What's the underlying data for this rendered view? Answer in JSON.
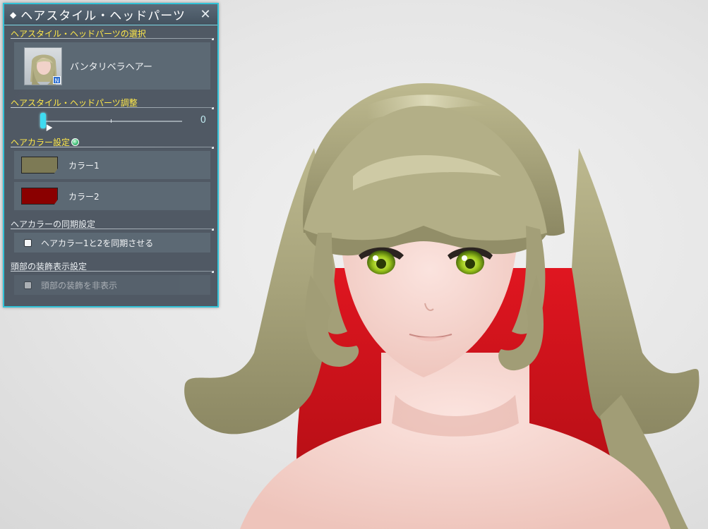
{
  "panel": {
    "title": "ヘアスタイル・ヘッドパーツ",
    "close_symbol": "✕"
  },
  "hair_select": {
    "heading": "ヘアスタイル・ヘッドパーツの選択",
    "selected_name": "バンタリベラヘアー",
    "thumb_badge": "N"
  },
  "hair_adjust": {
    "heading": "ヘアスタイル・ヘッドパーツ調整",
    "value": "0",
    "level_fraction": 0
  },
  "hair_color": {
    "heading": "ヘアカラー設定",
    "colors": [
      {
        "label": "カラー1",
        "hex": "#7d7a55"
      },
      {
        "label": "カラー2",
        "hex": "#8a0000"
      }
    ]
  },
  "sync": {
    "heading": "ヘアカラーの同期設定",
    "checkbox_label": "ヘアカラー1と2を同期させる",
    "checked": false
  },
  "head_deco": {
    "heading": "頭部の装飾表示設定",
    "checkbox_label": "頭部の装飾を非表示",
    "checked": false,
    "disabled": true
  },
  "theme": {
    "frame_accent": "#33c3d8",
    "heading_yellow": "#ffe94a",
    "panel_bg": "#46505b",
    "hair_color_main": "#a9a57d",
    "hair_color_under": "#c3141e",
    "eye_color": "#9cc61c"
  }
}
